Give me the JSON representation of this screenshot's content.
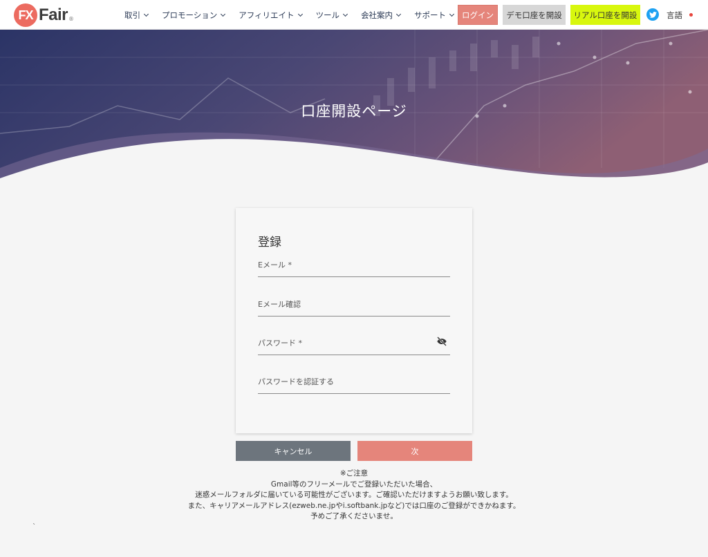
{
  "brand": {
    "logo_mark": "FX",
    "logo_word": "Fair",
    "logo_reg": "®",
    "accent": "#ec6b60"
  },
  "nav": [
    {
      "label": "取引"
    },
    {
      "label": "プロモーション"
    },
    {
      "label": "アフィリエイト"
    },
    {
      "label": "ツール"
    },
    {
      "label": "会社案内"
    },
    {
      "label": "サポート"
    }
  ],
  "header_buttons": {
    "login": "ログイン",
    "demo": "デモ口座を開設",
    "real": "リアル口座を開設"
  },
  "language": {
    "label": "言語",
    "icon": "twitter-icon"
  },
  "hero": {
    "title": "口座開設ページ"
  },
  "form": {
    "title": "登録",
    "fields": {
      "email": "Eメール *",
      "email_confirm": "Eメール確認",
      "password": "パスワード *",
      "password_confirm": "パスワードを認証する"
    },
    "password_toggle_icon": "eye-off-icon"
  },
  "actions": {
    "cancel": "キャンセル",
    "next": "次"
  },
  "notice": {
    "lines": [
      "※ご注意",
      "Gmail等のフリーメールでご登録いただいた場合、",
      "迷惑メールフォルダに届いている可能性がございます。ご確認いただけますようお願い致します。",
      "また、キャリアメールアドレス(ezweb.ne.jpやi.softbank.jpなど)では口座のご登録ができかねます。",
      "予めご了承くださいませ。"
    ]
  },
  "misc": {
    "tick": "`"
  }
}
